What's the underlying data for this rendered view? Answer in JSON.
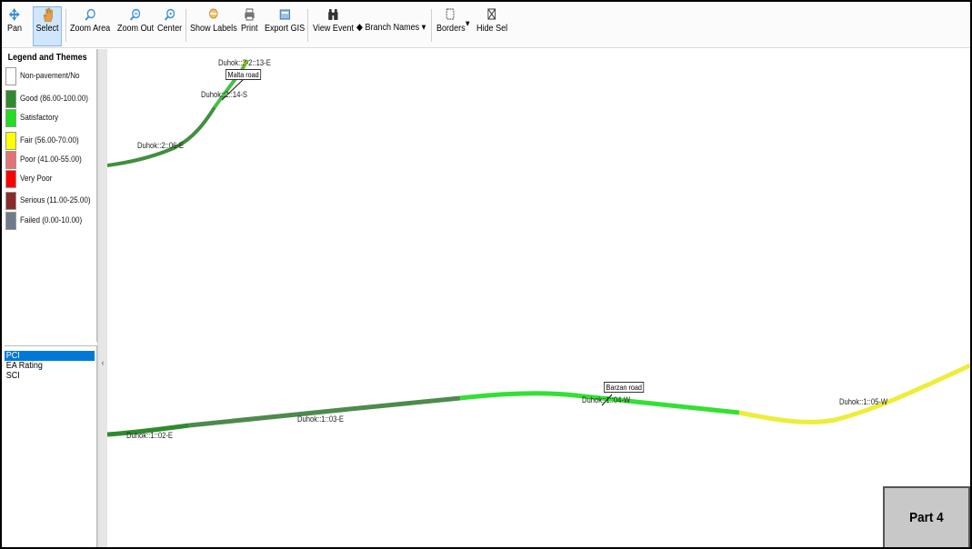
{
  "toolbar": {
    "pan": "Pan",
    "select": "Select",
    "zoom_area": "Zoom Area",
    "zoom_out": "Zoom Out",
    "center": "Center",
    "show_labels": "Show Labels",
    "print": "Print",
    "export_gis": "Export GIS",
    "view_event": "View Event",
    "branch_names": "Branch Names",
    "borders": "Borders",
    "hide_sel": "Hide Sel"
  },
  "legend": {
    "title": "Legend and Themes",
    "items": [
      {
        "label": "Non-pavement/No",
        "color": "#ffffff"
      },
      {
        "label": "Good (86.00-100.00)",
        "color": "#2e8b2e"
      },
      {
        "label": "Satisfactory",
        "color": "#22dd22"
      },
      {
        "label": "Fair (56.00-70.00)",
        "color": "#ffff00"
      },
      {
        "label": "Poor (41.00-55.00)",
        "color": "#e57373"
      },
      {
        "label": "Very Poor",
        "color": "#ff0000"
      },
      {
        "label": "Serious (11.00-25.00)",
        "color": "#8b2a2a"
      },
      {
        "label": "Failed (0.00-10.00)",
        "color": "#6e7b8b"
      }
    ]
  },
  "themes": {
    "items": [
      "PCI",
      "EA Rating",
      "SCI"
    ],
    "selected": "PCI"
  },
  "map": {
    "labels": {
      "l1": "Duhok::3-2::13-E",
      "l2": "Duhok::2::14-S",
      "l3": "Duhok::2::06-E",
      "l4": "Duhok::1::02-E",
      "l5": "Duhok::1::03-E",
      "l6": "Duhok::1::04-W",
      "l7": "Duhok::1::05-W"
    },
    "tags": {
      "malta": "Malta road",
      "barzan": "Barzan road"
    }
  },
  "overlay": {
    "part": "Part 4"
  }
}
